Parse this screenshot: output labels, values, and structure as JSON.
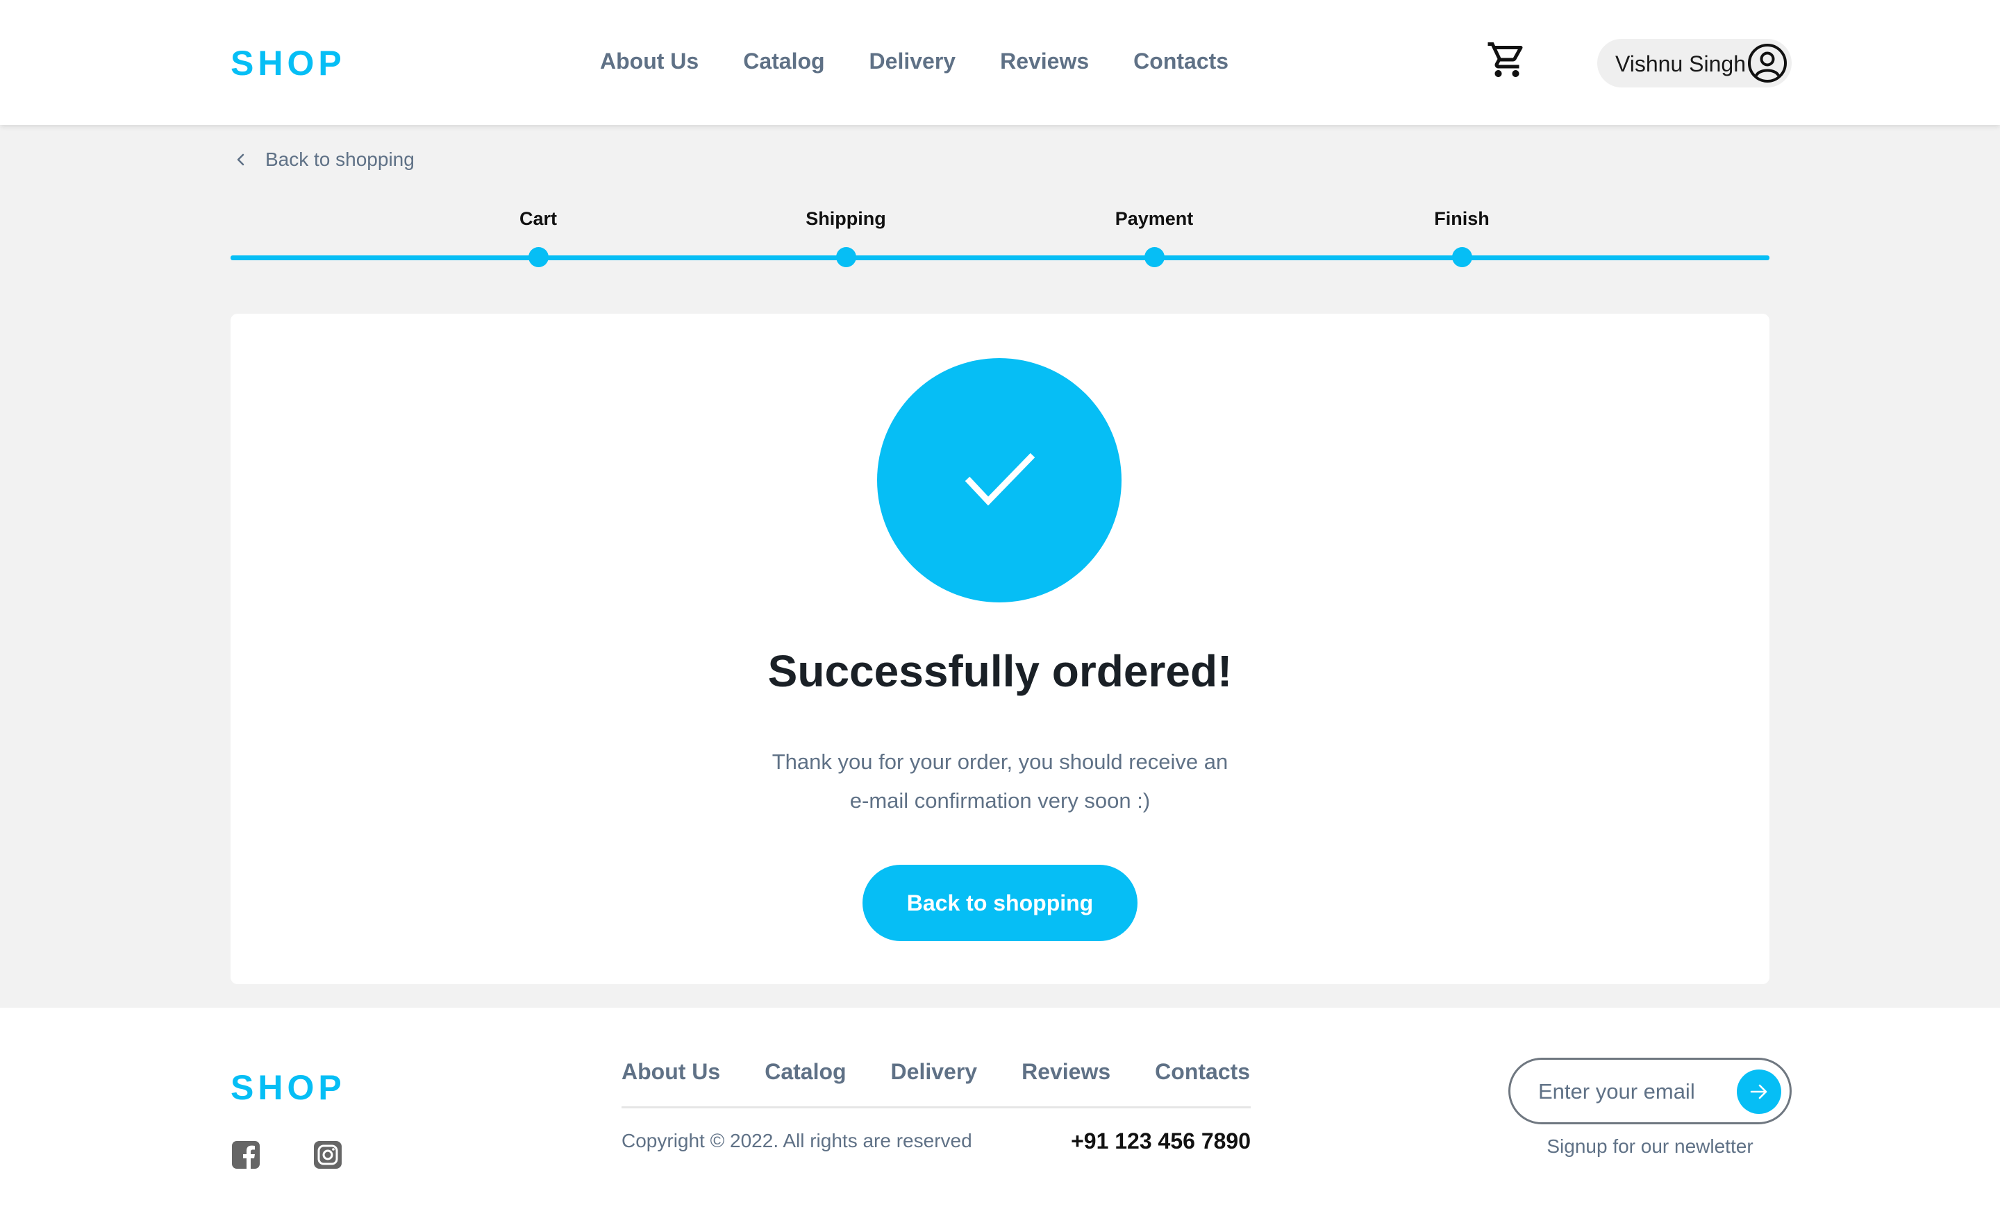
{
  "header": {
    "logo": "SHOP",
    "nav": [
      "About Us",
      "Catalog",
      "Delivery",
      "Reviews",
      "Contacts"
    ],
    "cart_icon": "cart-icon",
    "user": {
      "name": "Vishnu Singh",
      "icon": "user-circle-icon"
    }
  },
  "breadcrumb": {
    "label": "Back to shopping",
    "icon": "chevron-left-icon"
  },
  "stepper": {
    "steps": [
      "Cart",
      "Shipping",
      "Payment",
      "Finish"
    ],
    "completed_steps": 4
  },
  "confirmation": {
    "icon": "check-icon",
    "title": "Successfully ordered!",
    "message_line1": "Thank you for your order, you should receive an",
    "message_line2": "e-mail confirmation very soon :)",
    "button_label": "Back to shopping"
  },
  "footer": {
    "logo": "SHOP",
    "nav": [
      "About Us",
      "Catalog",
      "Delivery",
      "Reviews",
      "Contacts"
    ],
    "copyright": "Copyright © 2022. All rights are reserved",
    "phone": "+91 123 456 7890",
    "social": [
      "facebook-icon",
      "instagram-icon"
    ],
    "newsletter": {
      "placeholder": "Enter your email",
      "submit_icon": "arrow-right-icon",
      "caption": "Signup for our newletter"
    }
  },
  "colors": {
    "accent": "#06bef5",
    "muted_text": "#5f7186",
    "page_background": "#f2f2f2"
  }
}
